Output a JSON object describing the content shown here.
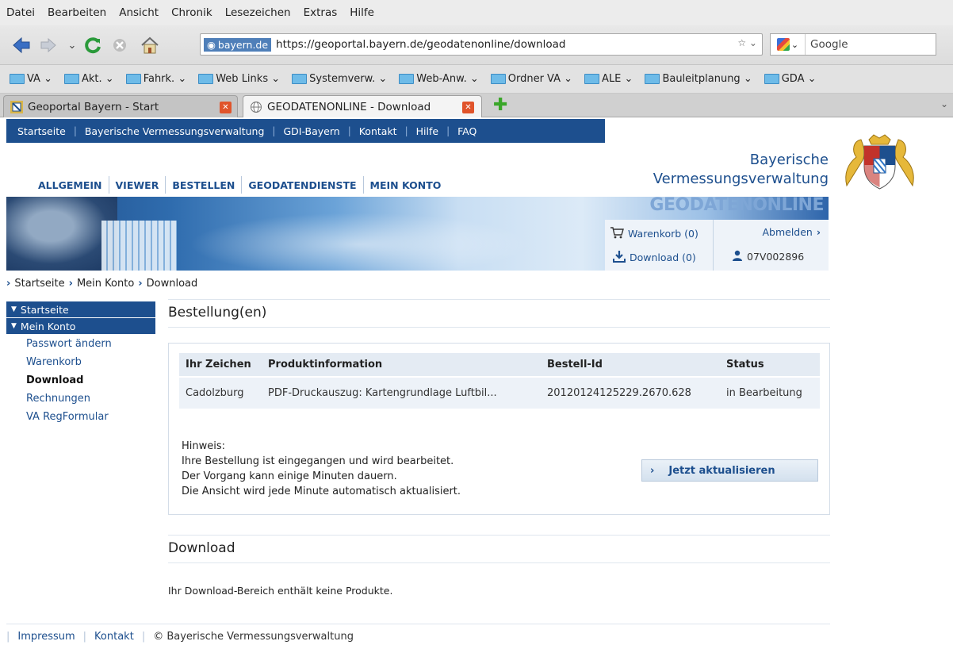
{
  "browser": {
    "menu": [
      "Datei",
      "Bearbeiten",
      "Ansicht",
      "Chronik",
      "Lesezeichen",
      "Extras",
      "Hilfe"
    ],
    "url_site": "bayern.de",
    "url": "https://geoportal.bayern.de/geodatenonline/download",
    "search_placeholder": "Google",
    "bookmarks": [
      "VA",
      "Akt.",
      "Fahrk.",
      "Web Links",
      "Systemverw.",
      "Web-Anw.",
      "Ordner VA",
      "ALE",
      "Bauleitplanung",
      "GDA"
    ],
    "tabs": [
      {
        "label": "Geoportal Bayern - Start"
      },
      {
        "label": "GEODATENONLINE - Download"
      }
    ]
  },
  "topnav": [
    "Startseite",
    "Bayerische Vermessungsverwaltung",
    "GDI-Bayern",
    "Kontakt",
    "Hilfe",
    "FAQ"
  ],
  "brand": {
    "line1": "Bayerische",
    "line2": "Vermessungsverwaltung",
    "banner_text": "GEODATENONLINE"
  },
  "mainnav": [
    "ALLGEMEIN",
    "VIEWER",
    "BESTELLEN",
    "GEODATENDIENSTE",
    "MEIN KONTO"
  ],
  "user_panel": {
    "cart": "Warenkorb (0)",
    "logout": "Abmelden",
    "download": "Download (0)",
    "user_id": "07V002896"
  },
  "breadcrumb": [
    "Startseite",
    "Mein Konto",
    "Download"
  ],
  "sidenav": {
    "heads": [
      "Startseite",
      "Mein Konto"
    ],
    "links": [
      "Passwort ändern",
      "Warenkorb",
      "Download",
      "Rechnungen",
      "VA RegFormular"
    ]
  },
  "orders": {
    "title": "Bestellung(en)",
    "columns": [
      "Ihr Zeichen",
      "Produktinformation",
      "Bestell-Id",
      "Status"
    ],
    "rows": [
      {
        "zeichen": "Cadolzburg",
        "produkt": "PDF-Druckauszug: Kartengrundlage Luftbil...",
        "id": "20120124125229.2670.628",
        "status": "in Bearbeitung"
      }
    ],
    "hint_lines": [
      "Hinweis:",
      "Ihre Bestellung ist eingegangen und wird bearbeitet.",
      "Der Vorgang kann einige Minuten dauern.",
      "Die Ansicht wird jede Minute automatisch aktualisiert."
    ],
    "refresh_label": "Jetzt aktualisieren"
  },
  "download": {
    "title": "Download",
    "empty_text": "Ihr Download-Bereich enthält keine Produkte."
  },
  "footer": {
    "impressum": "Impressum",
    "kontakt": "Kontakt",
    "copyright": "© Bayerische Vermessungsverwaltung"
  },
  "colors": {
    "primary": "#1d4f8e",
    "status_ok": "#2f8a2f",
    "tab_close": "#e0542b"
  }
}
